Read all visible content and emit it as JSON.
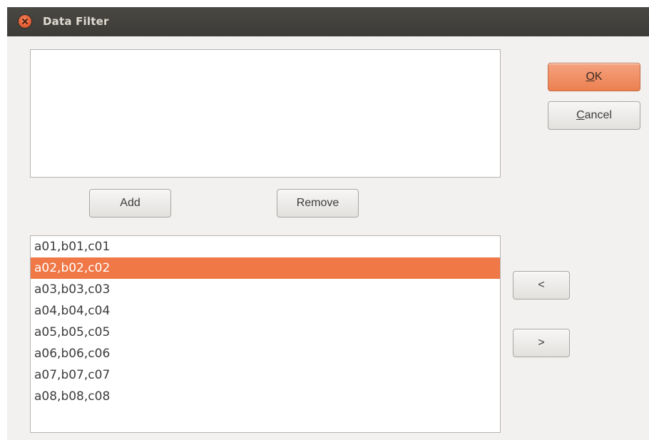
{
  "window": {
    "title": "Data Filter"
  },
  "buttons": {
    "ok_label": "OK",
    "cancel_label": "Cancel",
    "add_label": "Add",
    "remove_label": "Remove",
    "move_left_label": "<",
    "move_right_label": ">"
  },
  "filter_list": {
    "items": []
  },
  "data_list": {
    "items": [
      "a01,b01,c01",
      "a02,b02,c02",
      "a03,b03,c03",
      "a04,b04,c04",
      "a05,b05,c05",
      "a06,b06,c06",
      "a07,b07,c07",
      "a08,b08,c08"
    ],
    "selected_index": 1
  },
  "colors": {
    "accent": "#f07746",
    "titlebar": "#3c3b37",
    "window_bg": "#f2f1f0"
  },
  "icons": {
    "close": "close-icon"
  }
}
